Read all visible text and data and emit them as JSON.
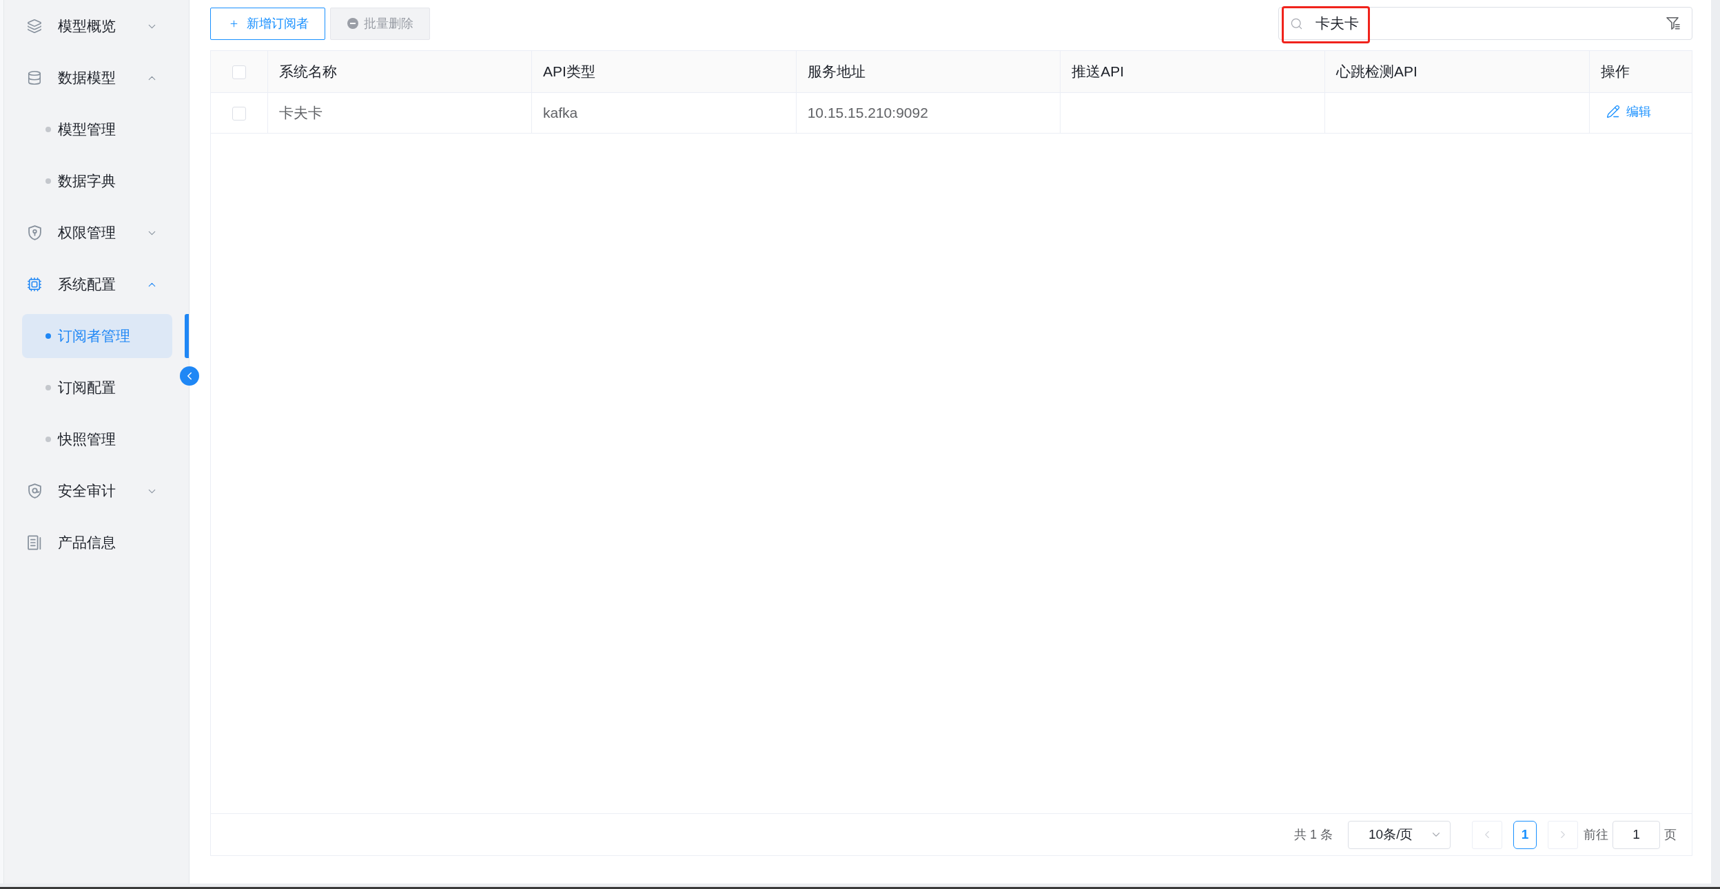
{
  "sidebar": {
    "items": [
      {
        "label": "模型概览",
        "kind": "group",
        "expanded": false
      },
      {
        "label": "数据模型",
        "kind": "group",
        "expanded": true,
        "children": [
          {
            "label": "模型管理",
            "selected": false
          },
          {
            "label": "数据字典",
            "selected": false
          }
        ]
      },
      {
        "label": "权限管理",
        "kind": "group",
        "expanded": false
      },
      {
        "label": "系统配置",
        "kind": "group",
        "expanded": true,
        "children": [
          {
            "label": "订阅者管理",
            "selected": true
          },
          {
            "label": "订阅配置",
            "selected": false
          },
          {
            "label": "快照管理",
            "selected": false
          }
        ]
      },
      {
        "label": "安全审计",
        "kind": "group",
        "expanded": false
      },
      {
        "label": "产品信息",
        "kind": "link",
        "selected": false
      }
    ]
  },
  "toolbar": {
    "buttons": [
      {
        "label": "新增订阅者",
        "kind": "add",
        "disabled": false
      },
      {
        "label": "批量删除",
        "kind": "delete",
        "disabled": true
      }
    ]
  },
  "search": {
    "value": "卡夫卡",
    "highlighted": true
  },
  "table": {
    "select_all": {
      "checked": false
    },
    "columns": [
      {
        "label": "系统名称",
        "kind": "text"
      },
      {
        "label": "API类型",
        "kind": "text"
      },
      {
        "label": "服务地址",
        "kind": "text"
      },
      {
        "label": "推送API",
        "kind": "text"
      },
      {
        "label": "心跳检测API",
        "kind": "text"
      },
      {
        "label": "操作",
        "kind": "actions"
      }
    ],
    "rows": [
      {
        "checked": false,
        "cells": [
          "卡夫卡",
          "kafka",
          "10.15.15.210:9092"
        ],
        "actions": [
          {
            "label": "编辑",
            "kind": "edit"
          }
        ]
      }
    ]
  },
  "pagination": {
    "total": "共 1 条",
    "page_size": "10条/页",
    "prev": {
      "disabled": true
    },
    "pages": [
      {
        "label": "1",
        "selected": true
      }
    ],
    "next": {
      "disabled": true
    },
    "goto_label": "前往",
    "goto_value": "1",
    "goto_unit": "页"
  }
}
